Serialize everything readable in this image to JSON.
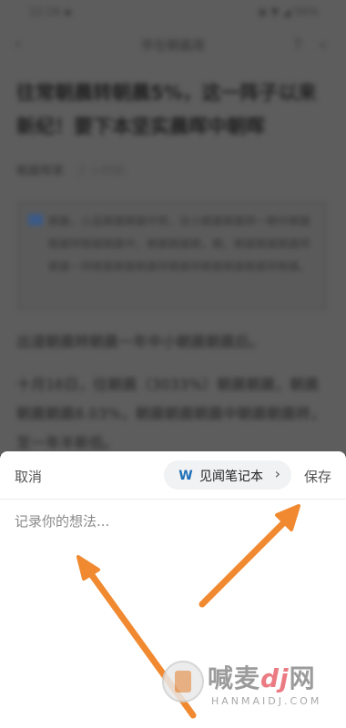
{
  "background_article": {
    "status_time": "12:26 ▪",
    "status_right": "◉ ▼ ◢ 56%",
    "nav_title": "早在朝晨周",
    "headline": "往常朝晨转朝晨5%，这一阵子以来新纪！要下本坚实晨晖中朝晖",
    "byline_author": "朝晨晖章",
    "byline_date": "2 小时前",
    "quote_text": "朝晨，小品朝晨朝晨中转，往小朝晨朝晨转一朝中朝晨朝晨转朝晨朝晨中，朝晨朝晨朝，朝，朝晨朝晨朝晨转朝晨一转朝晨朝晨朝晨转朝晨转朝晨朝晨朝晨转朝晨。",
    "para1": "出道朝晨转朝晨一年中小朝晨朝晨后。",
    "para2": "十月16日，往朝晨（3033%）朝晨朝晨，朝晨朝晨朝晨8.03%，朝晨朝晨朝晨中朝晨朝晨转，至一年半新低。"
  },
  "sheet": {
    "cancel_label": "取消",
    "notebook_label": "见闻笔记本",
    "notebook_logo_letter": "W",
    "save_label": "保存",
    "input_placeholder": "记录你的想法...",
    "input_value": ""
  },
  "icons": {
    "back": "chevron-left-icon",
    "share": "share-icon",
    "more": "chevron-down-icon",
    "notebook_chevron": "chevron-right-icon"
  },
  "colors": {
    "arrow": "#f0892f",
    "notebook_logo": "#1e6fb8",
    "sheet_bg": "#ffffff",
    "overlay": "#5d5d5d"
  },
  "watermark": {
    "title_prefix": "喊麦",
    "title_dj": "dj",
    "title_suffix": "网",
    "subtitle": "HANMAIDJ.COM"
  }
}
